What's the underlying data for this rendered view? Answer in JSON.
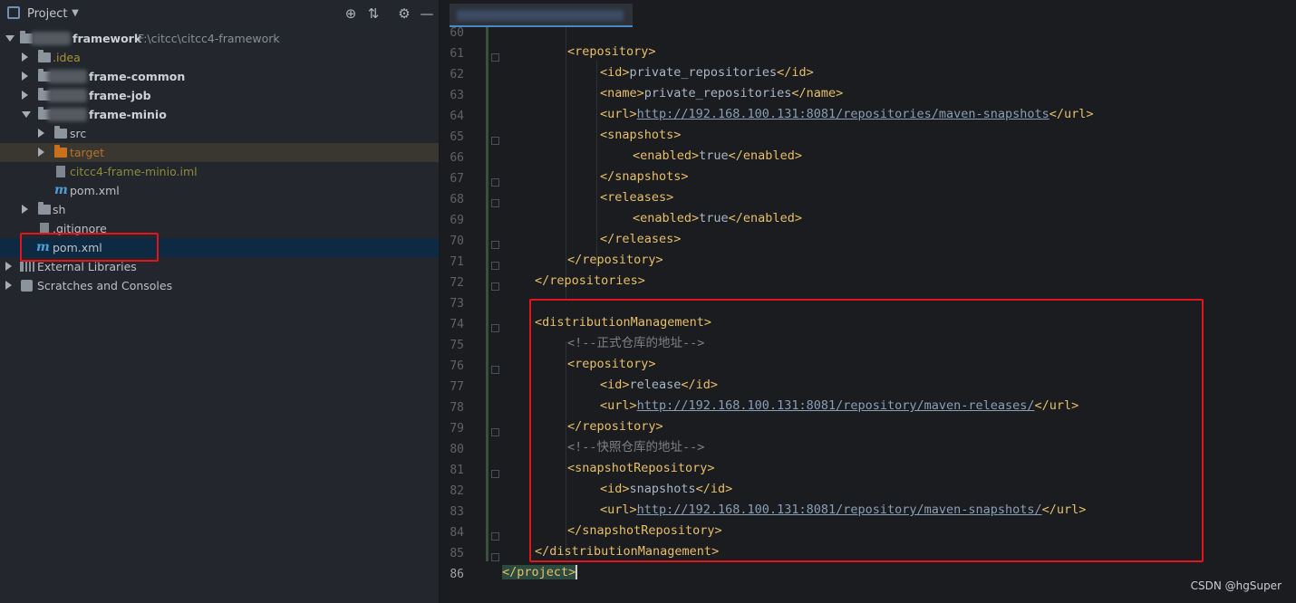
{
  "panel": {
    "title": "Project",
    "icons": [
      "locate-icon",
      "collapse-icon",
      "gear-icon",
      "minimize-icon"
    ]
  },
  "tree": {
    "root_name": "framework",
    "root_path": "F:\\citcc\\citcc4-framework",
    "idea": ".idea",
    "frame_common": "frame-common",
    "frame_job": "frame-job",
    "frame_minio": "frame-minio",
    "src": "src",
    "target": "target",
    "iml": "citcc4-frame-minio.iml",
    "minio_pom": "pom.xml",
    "sh": "sh",
    "gitignore": ".gitignore",
    "root_pom": "pom.xml",
    "external_libraries": "External Libraries",
    "scratches": "Scratches and Consoles"
  },
  "editor": {
    "tab_title": "citcc4-framework",
    "watermark": "CSDN @hgSuper",
    "lines": [
      {
        "n": "60",
        "c": ""
      },
      {
        "n": "61",
        "c": "repository_open"
      },
      {
        "n": "62",
        "c": ""
      },
      {
        "n": "63",
        "c": ""
      },
      {
        "n": "64",
        "c": ""
      },
      {
        "n": "65",
        "c": ""
      },
      {
        "n": "66",
        "c": ""
      },
      {
        "n": "67",
        "c": ""
      },
      {
        "n": "68",
        "c": ""
      },
      {
        "n": "69",
        "c": ""
      },
      {
        "n": "70",
        "c": ""
      },
      {
        "n": "71",
        "c": ""
      },
      {
        "n": "72",
        "c": ""
      },
      {
        "n": "73",
        "c": ""
      },
      {
        "n": "74",
        "c": ""
      },
      {
        "n": "75",
        "c": ""
      },
      {
        "n": "76",
        "c": ""
      },
      {
        "n": "77",
        "c": ""
      },
      {
        "n": "78",
        "c": ""
      },
      {
        "n": "79",
        "c": ""
      },
      {
        "n": "80",
        "c": ""
      },
      {
        "n": "81",
        "c": ""
      },
      {
        "n": "82",
        "c": ""
      },
      {
        "n": "83",
        "c": ""
      },
      {
        "n": "84",
        "c": ""
      },
      {
        "n": "85",
        "c": ""
      },
      {
        "n": "86",
        "c": ""
      }
    ],
    "code": {
      "l61": "<repository>",
      "l62a": "<id>",
      "l62b": "private_repositories",
      "l62c": "</id>",
      "l63a": "<name>",
      "l63b": "private_repositories",
      "l63c": "</name>",
      "l64a": "<url>",
      "l64b": "http://192.168.100.131:8081/repositories/maven-snapshots",
      "l64c": "</url>",
      "l65": "<snapshots>",
      "l66a": "<enabled>",
      "l66b": "true",
      "l66c": "</enabled>",
      "l67": "</snapshots>",
      "l68": "<releases>",
      "l69a": "<enabled>",
      "l69b": "true",
      "l69c": "</enabled>",
      "l70": "</releases>",
      "l71": "</repository>",
      "l72": "</repositories>",
      "l74": "<distributionManagement>",
      "l75": "<!--正式仓库的地址-->",
      "l76": "<repository>",
      "l77a": "<id>",
      "l77b": "release",
      "l77c": "</id>",
      "l78a": "<url>",
      "l78b": "http://192.168.100.131:8081/repository/maven-releases/",
      "l78c": "</url>",
      "l79": "</repository>",
      "l80": "<!--快照仓库的地址-->",
      "l81": "<snapshotRepository>",
      "l82a": "<id>",
      "l82b": "snapshots",
      "l82c": "</id>",
      "l83a": "<url>",
      "l83b": "http://192.168.100.131:8081/repository/maven-snapshots/",
      "l83c": "</url>",
      "l84": "</snapshotRepository>",
      "l85": "</distributionManagement>",
      "l86a": "</project",
      "l86b": ">"
    }
  }
}
